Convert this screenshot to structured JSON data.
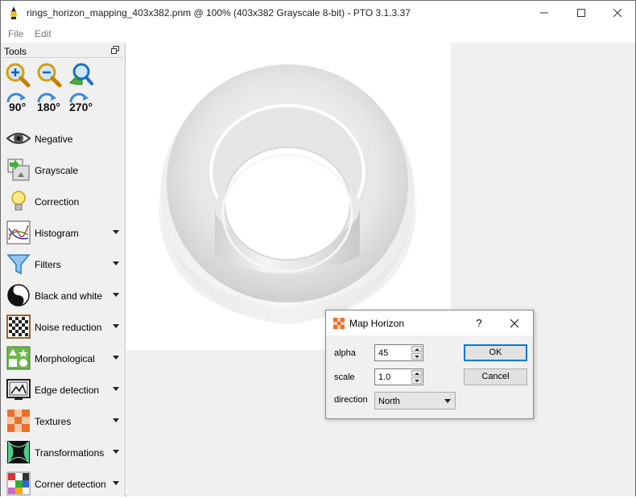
{
  "window": {
    "title": "rings_horizon_mapping_403x382.pnm @ 100% (403x382 Grayscale 8-bit) - PTO 3.1.3.37"
  },
  "menu": {
    "items": [
      "File",
      "Edit"
    ]
  },
  "tools": {
    "header": "Tools",
    "top_icons": [
      {
        "name": "zoom-in-icon"
      },
      {
        "name": "zoom-out-icon"
      },
      {
        "name": "zoom-fit-icon"
      }
    ],
    "rotate_icons": [
      {
        "name": "rotate-90-icon",
        "label": "90°"
      },
      {
        "name": "rotate-180-icon",
        "label": "180°"
      },
      {
        "name": "rotate-270-icon",
        "label": "270°"
      }
    ],
    "items": [
      {
        "label": "Negative",
        "icon": "eye-icon",
        "has_menu": false
      },
      {
        "label": "Grayscale",
        "icon": "grayscale-icon",
        "has_menu": false
      },
      {
        "label": "Correction",
        "icon": "lightbulb-icon",
        "has_menu": false
      },
      {
        "label": "Histogram",
        "icon": "histogram-icon",
        "has_menu": true
      },
      {
        "label": "Filters",
        "icon": "funnel-icon",
        "has_menu": true
      },
      {
        "label": "Black and white",
        "icon": "yin-yang-icon",
        "has_menu": true
      },
      {
        "label": "Noise reduction",
        "icon": "checkerboard-icon",
        "has_menu": true
      },
      {
        "label": "Morphological",
        "icon": "shapes-icon",
        "has_menu": true
      },
      {
        "label": "Edge detection",
        "icon": "edge-icon",
        "has_menu": true
      },
      {
        "label": "Textures",
        "icon": "textures-icon",
        "has_menu": true
      },
      {
        "label": "Transformations",
        "icon": "transform-icon",
        "has_menu": true
      },
      {
        "label": "Corner detection",
        "icon": "corner-icon",
        "has_menu": true
      }
    ]
  },
  "dialog": {
    "title": "Map Horizon",
    "help": "?",
    "fields": {
      "alpha": {
        "label": "alpha",
        "value": "45"
      },
      "scale": {
        "label": "scale",
        "value": "1.0"
      },
      "direction": {
        "label": "direction",
        "value": "North"
      }
    },
    "ok_label": "OK",
    "cancel_label": "Cancel"
  },
  "colors": {
    "accent": "#0078d7",
    "panel": "#f0f0f0"
  }
}
